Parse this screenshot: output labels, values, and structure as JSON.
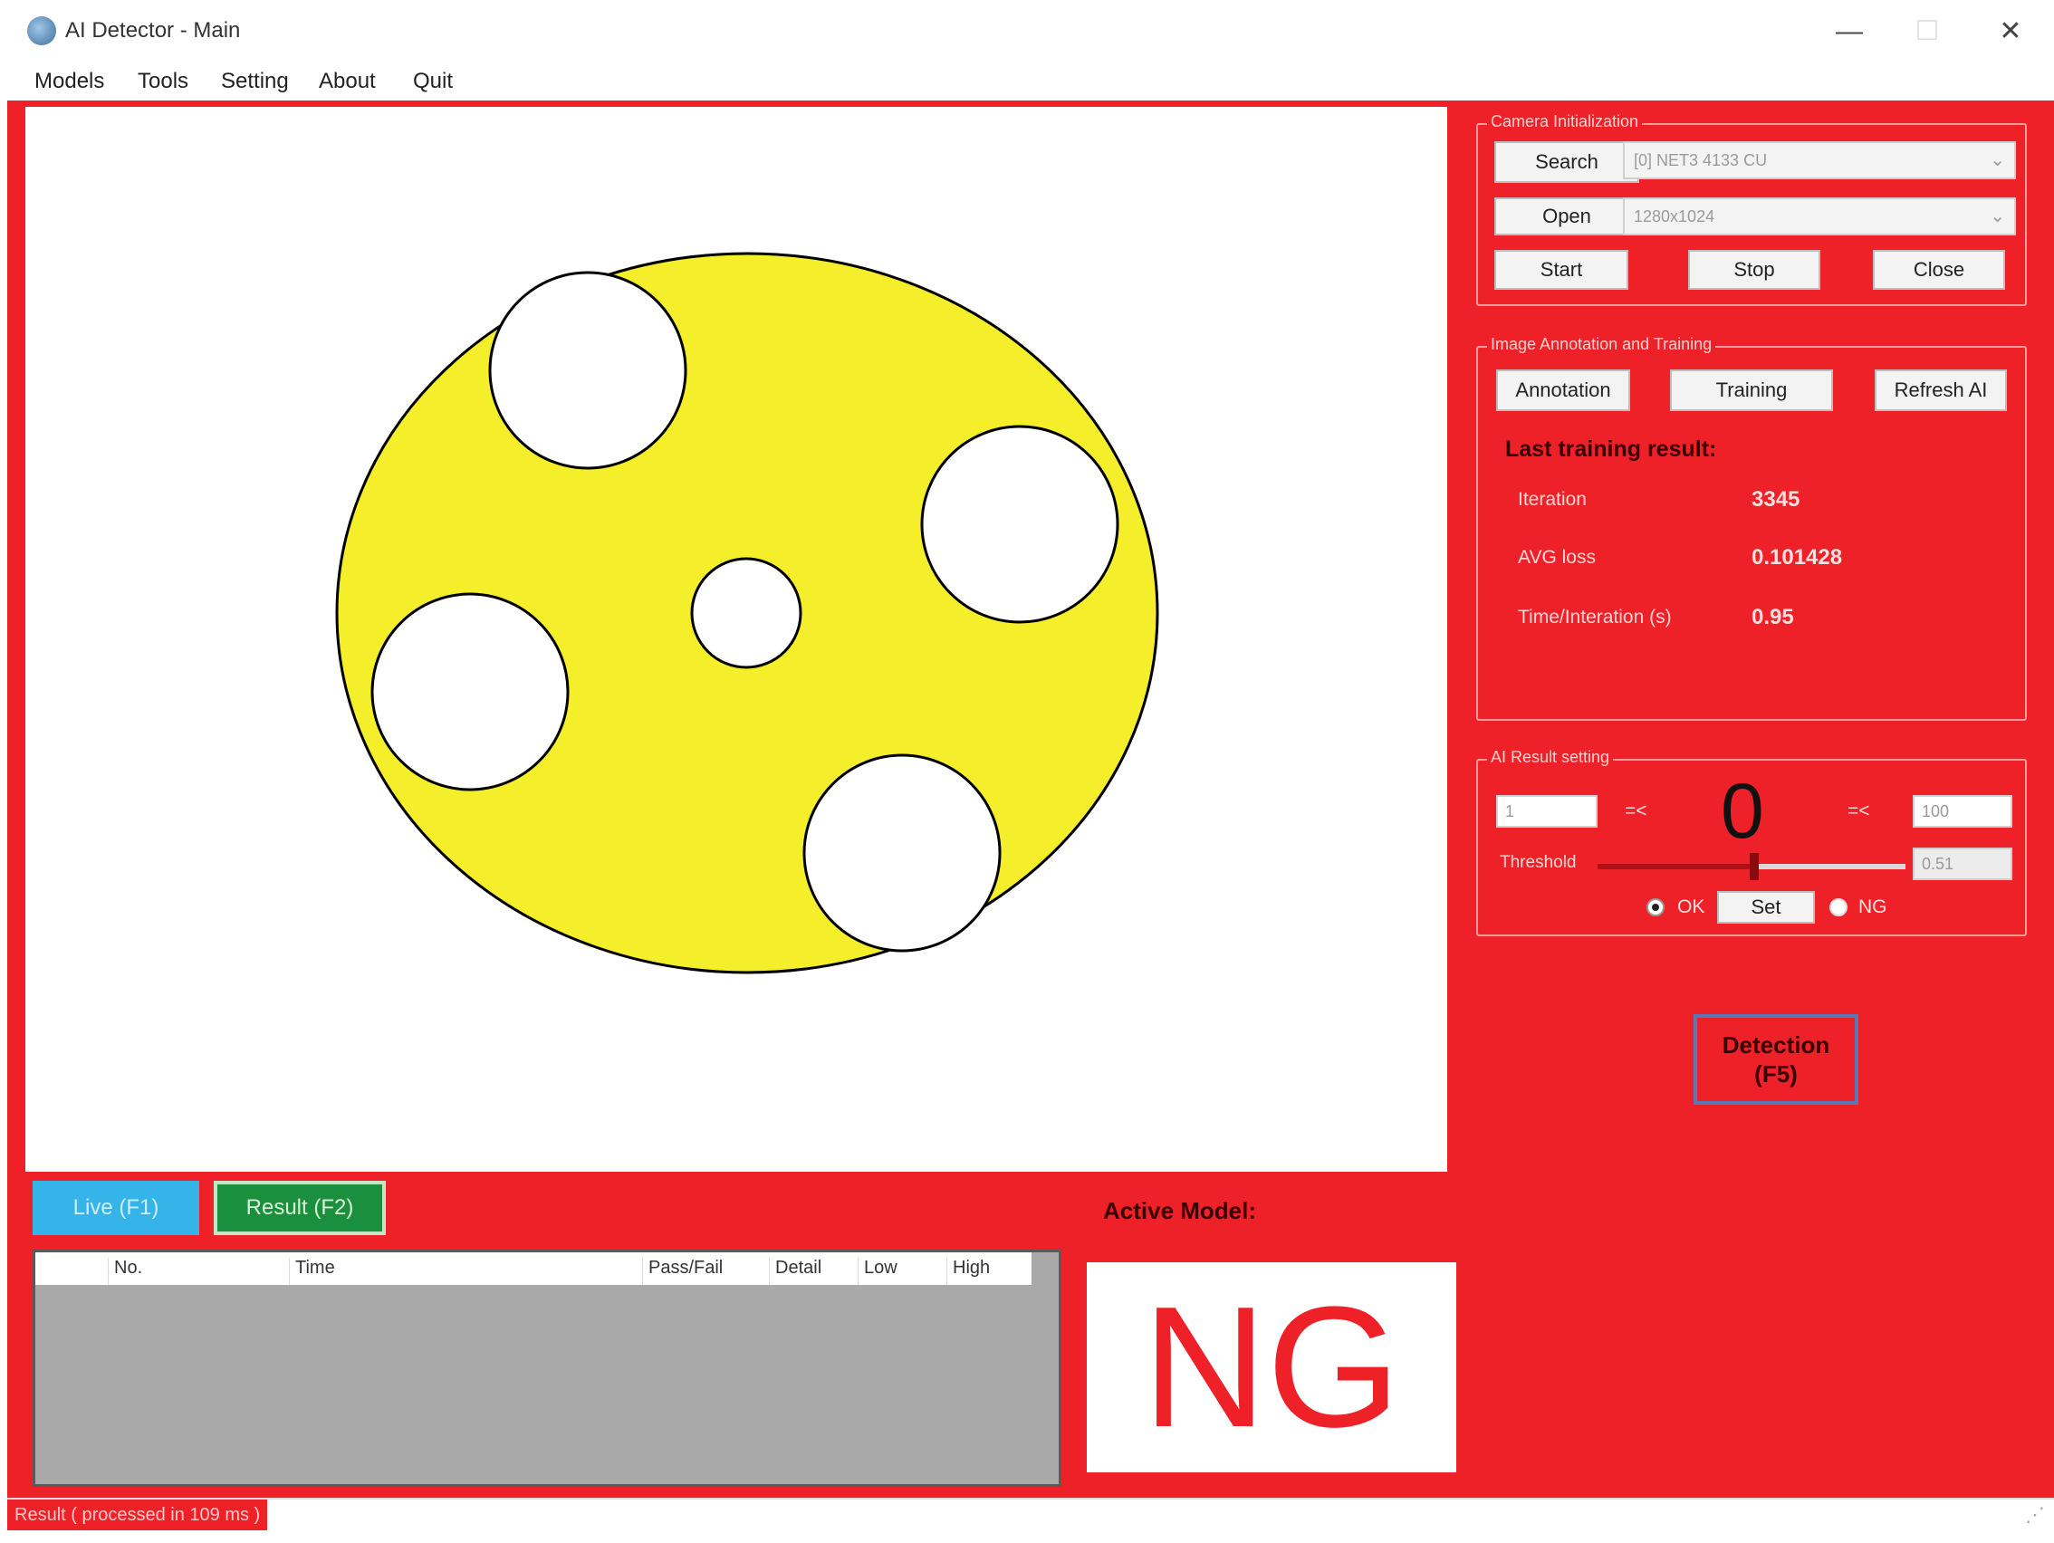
{
  "window": {
    "title": "AI Detector - Main",
    "minimize": "—",
    "maximize": "☐",
    "close": "✕"
  },
  "menu": [
    "Models",
    "Tools",
    "Setting",
    "About",
    "Quit"
  ],
  "camera": {
    "title": "Camera Initialization",
    "search_label": "Search",
    "device_value": "[0] NET3 4133 CU",
    "open_label": "Open",
    "resolution_value": "1280x1024",
    "start_label": "Start",
    "stop_label": "Stop",
    "close_label": "Close"
  },
  "training": {
    "title": "Image Annotation and Training",
    "annotation_label": "Annotation",
    "training_label": "Training",
    "refresh_label": "Refresh AI",
    "last_result_label": "Last training result:",
    "rows": [
      {
        "label": "Iteration",
        "value": "3345"
      },
      {
        "label": "AVG loss",
        "value": "0.101428"
      },
      {
        "label": "Time/Interation (s)",
        "value": "0.95"
      }
    ]
  },
  "ai_result": {
    "title": "AI Result setting",
    "low_value": "1",
    "le1": "=<",
    "count": "0",
    "le2": "=<",
    "high_value": "100",
    "threshold_label": "Threshold",
    "threshold_value": "0.51",
    "threshold_level": 0.51,
    "ok_label": "OK",
    "set_label": "Set",
    "ng_label": "NG"
  },
  "detection": {
    "line1": "Detection",
    "line2": "(F5)"
  },
  "tabs": {
    "live": "Live (F1)",
    "result": "Result (F2)"
  },
  "grid": {
    "columns": [
      "No.",
      "Time",
      "Pass/Fail",
      "Detail",
      "Low",
      "High"
    ]
  },
  "active_model_label": "Active Model:",
  "result_text": "NG",
  "status": "Result ( processed in 109 ms )",
  "colors": {
    "accent_red": "#ee2028",
    "part_yellow": "#f5ee2a",
    "live_blue": "#34b4e9",
    "result_green": "#1a8f3d"
  }
}
